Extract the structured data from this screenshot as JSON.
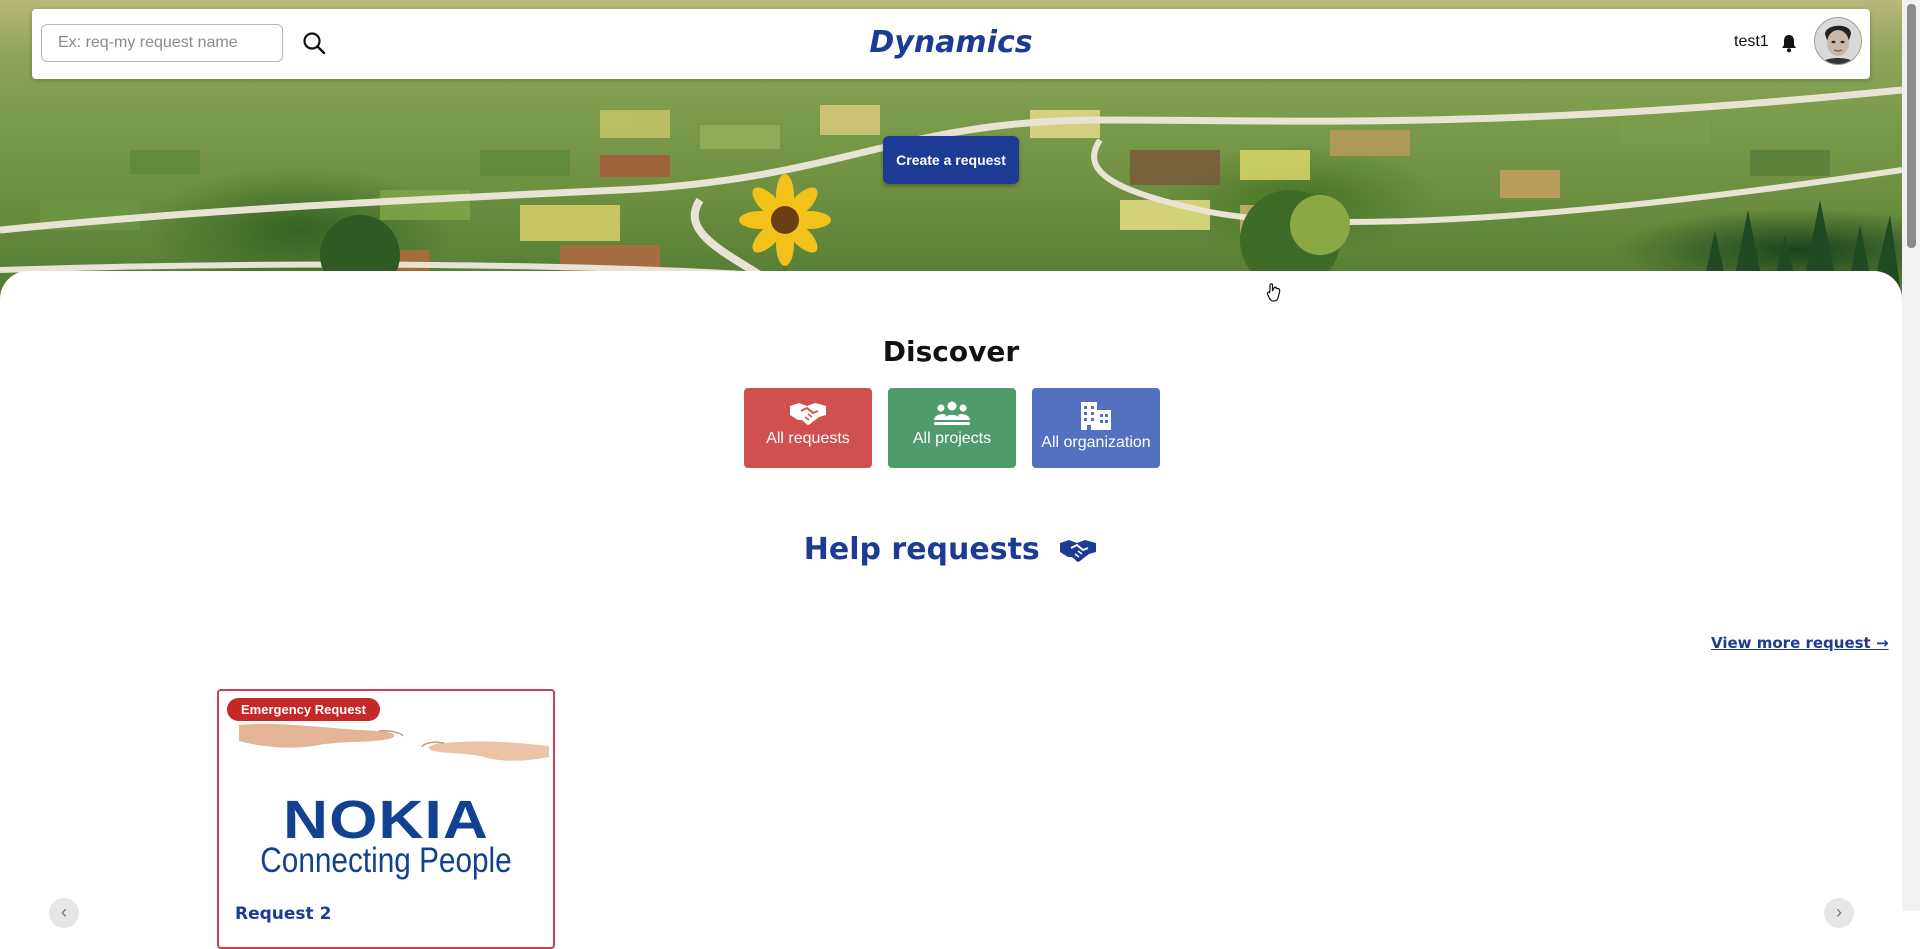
{
  "header": {
    "search": {
      "placeholder": "Ex: req-my request name",
      "value": ""
    },
    "brand": "Dynamics",
    "username": "test1",
    "icons": {
      "search": "search-icon",
      "bell": "bell-icon",
      "avatar": "user-avatar"
    }
  },
  "hero": {
    "create_button": "Create a request"
  },
  "discover": {
    "title": "Discover",
    "tiles": [
      {
        "label": "All requests",
        "icon": "handshake-icon",
        "color": "#d0504f"
      },
      {
        "label": "All projects",
        "icon": "users-icon",
        "color": "#4e9c6b"
      },
      {
        "label": "All organization",
        "icon": "building-icon",
        "color": "#5470c0"
      }
    ]
  },
  "help_requests": {
    "title": "Help requests",
    "icon": "handshake-icon",
    "view_more": "View more request →",
    "cards": [
      {
        "badge": "Emergency Request",
        "brand_text": "NOKIA",
        "tagline": "Connecting People",
        "title": "Request 2"
      }
    ]
  },
  "carousel": {
    "prev_icon": "chevron-left-icon",
    "next_icon": "chevron-right-icon"
  },
  "colors": {
    "primary": "#1d3b94",
    "emergency": "#c62828",
    "card_border": "#d23a56"
  }
}
